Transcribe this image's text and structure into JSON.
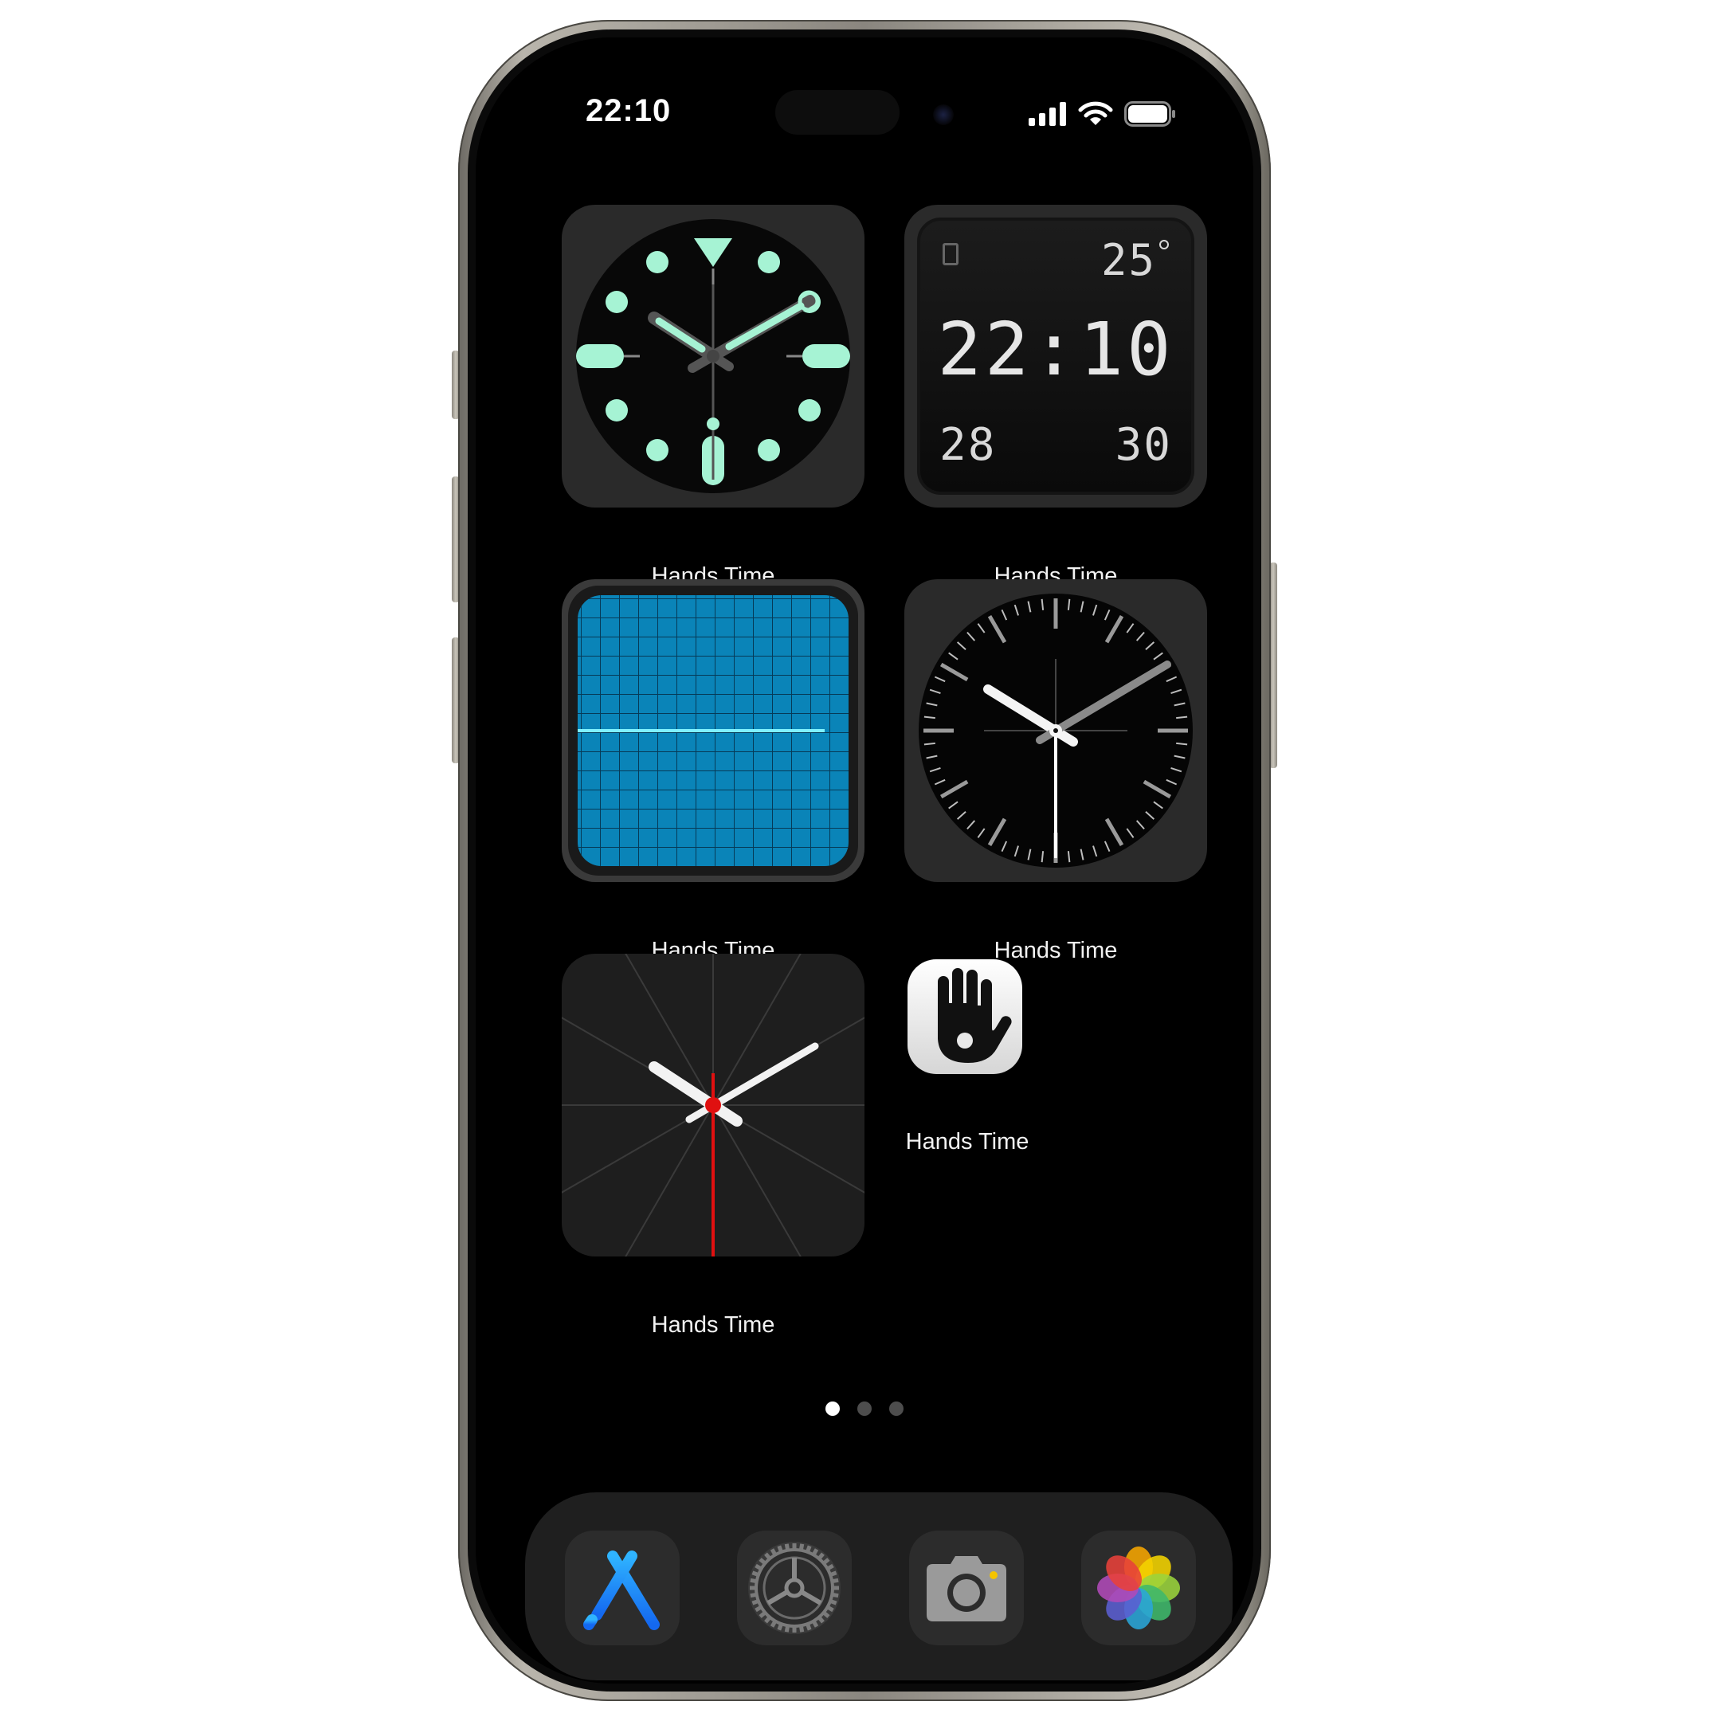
{
  "status_bar": {
    "time": "22:10"
  },
  "widgets": [
    {
      "label": "Hands Time"
    },
    {
      "label": "Hands Time",
      "temperature": "25",
      "time": "22:10",
      "left_value": "28",
      "right_value": "30"
    },
    {
      "label": "Hands Time"
    },
    {
      "label": "Hands Time"
    },
    {
      "label": "Hands Time"
    }
  ],
  "app_icon": {
    "label": "Hands Time",
    "icon": "raised-hand-icon"
  },
  "page_indicator": {
    "pages": 3,
    "current": 1
  },
  "dock": [
    {
      "name": "App Store",
      "icon": "app-store-icon"
    },
    {
      "name": "Settings",
      "icon": "gear-icon"
    },
    {
      "name": "Camera",
      "icon": "camera-icon"
    },
    {
      "name": "Photos",
      "icon": "photos-icon"
    }
  ],
  "colors": {
    "lume": "#a6f3d4",
    "grid_blue": "#0a84b8",
    "second_hand_red": "#e01010"
  }
}
